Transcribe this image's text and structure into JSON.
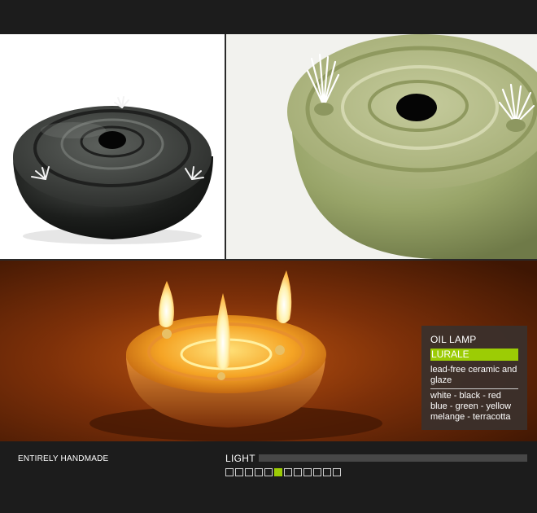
{
  "info": {
    "title": "OIL LAMP",
    "name": "LURALE",
    "description": "lead-free ceramic and glaze",
    "colors": [
      "white - black - red",
      "blue - green - yellow",
      "melange - terracotta"
    ]
  },
  "footer": {
    "tagline": "ENTIRELY HANDMADE",
    "light_label": "LIGHT",
    "gallery": {
      "total": 12,
      "active_index": 5
    }
  },
  "accent_color": "#9ccc05"
}
